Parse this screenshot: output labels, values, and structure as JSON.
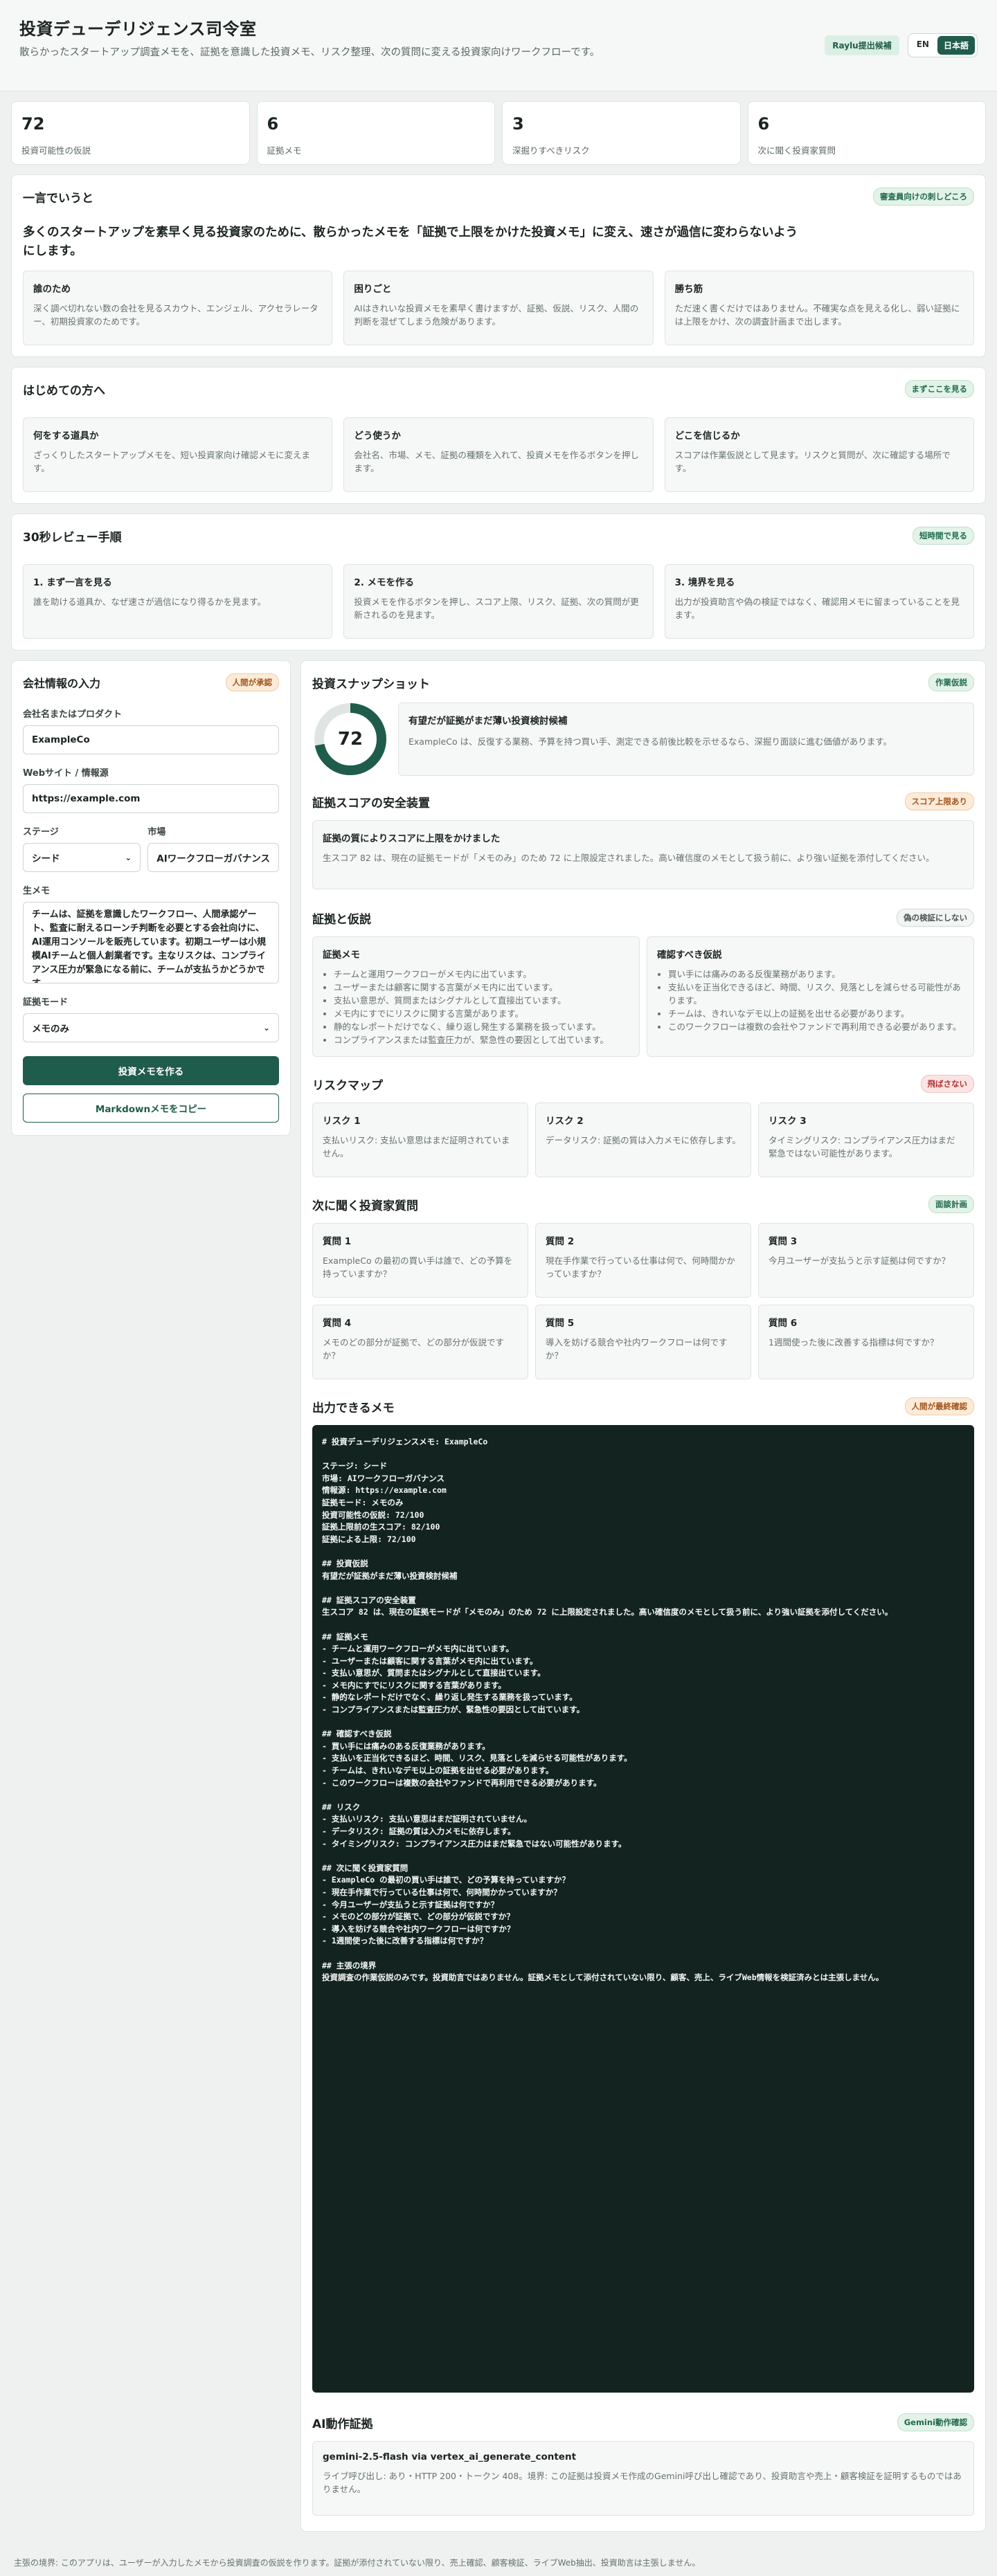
{
  "header": {
    "title": "投資デューデリジェンス司令室",
    "subtitle": "散らかったスタートアップ調査メモを、証拠を意識した投資メモ、リスク整理、次の質問に変える投資家向けワークフローです。",
    "badge": "Raylu提出候補",
    "lang_en": "EN",
    "lang_ja": "日本語"
  },
  "stats": [
    {
      "value": "72",
      "label": "投資可能性の仮説"
    },
    {
      "value": "6",
      "label": "証拠メモ"
    },
    {
      "value": "3",
      "label": "深掘りすべきリスク"
    },
    {
      "value": "6",
      "label": "次に聞く投資家質問"
    }
  ],
  "summary": {
    "title": "一言でいうと",
    "pill": "審査員向けの刺しどころ",
    "lead": "多くのスタートアップを素早く見る投資家のために、散らかったメモを「証拠で上限をかけた投資メモ」に変え、速さが過信に変わらないようにします。",
    "cards": [
      {
        "title": "誰のため",
        "body": "深く調べ切れない数の会社を見るスカウト、エンジェル、アクセラレーター、初期投資家のためです。"
      },
      {
        "title": "困りごと",
        "body": "AIはきれいな投資メモを素早く書けますが、証拠、仮説、リスク、人間の判断を混ぜてしまう危険があります。"
      },
      {
        "title": "勝ち筋",
        "body": "ただ速く書くだけではありません。不確実な点を見える化し、弱い証拠には上限をかけ、次の調査計画まで出します。"
      }
    ]
  },
  "intro": {
    "title": "はじめての方へ",
    "pill": "まずここを見る",
    "cards": [
      {
        "title": "何をする道具か",
        "body": "ざっくりしたスタートアップメモを、短い投資家向け確認メモに変えます。"
      },
      {
        "title": "どう使うか",
        "body": "会社名、市場、メモ、証拠の種類を入れて、投資メモを作るボタンを押します。"
      },
      {
        "title": "どこを信じるか",
        "body": "スコアは作業仮説として見ます。リスクと質問が、次に確認する場所です。"
      }
    ]
  },
  "review": {
    "title": "30秒レビュー手順",
    "pill": "短時間で見る",
    "cards": [
      {
        "title": "1. まず一言を見る",
        "body": "誰を助ける道具か、なぜ速さが過信になり得るかを見ます。"
      },
      {
        "title": "2. メモを作る",
        "body": "投資メモを作るボタンを押し、スコア上限、リスク、証拠、次の質問が更新されるのを見ます。"
      },
      {
        "title": "3. 境界を見る",
        "body": "出力が投資助言や偽の検証ではなく、確認用メモに留まっていることを見ます。"
      }
    ]
  },
  "form": {
    "title": "会社情報の入力",
    "pill": "人間が承認",
    "company_label": "会社名またはプロダクト",
    "company_value": "ExampleCo",
    "website_label": "Webサイト / 情報源",
    "website_value": "https://example.com",
    "stage_label": "ステージ",
    "stage_value": "シード",
    "market_label": "市場",
    "market_value": "AIワークフローガバナンス",
    "notes_label": "生メモ",
    "notes_value": "チームは、証拠を意識したワークフロー、人間承認ゲート、監査に耐えるローンチ判断を必要とする会社向けに、AI運用コンソールを販売しています。初期ユーザーは小規模AIチームと個人創業者です。主なリスクは、コンプライアンス圧力が緊急になる前に、チームが支払うかどうかです。",
    "mode_label": "証拠モード",
    "mode_value": "メモのみ",
    "generate_button": "投資メモを作る",
    "copy_button": "Markdownメモをコピー"
  },
  "snapshot": {
    "title": "投資スナップショット",
    "pill": "作業仮説",
    "score": "72",
    "score_fraction": 0.72,
    "heading": "有望だが証拠がまだ薄い投資検討候補",
    "body": "ExampleCo は、反復する業務、予算を持つ買い手、測定できる前後比較を示せるなら、深掘り面談に進む価値があります。"
  },
  "guard": {
    "title": "証拠スコアの安全装置",
    "pill": "スコア上限あり",
    "heading": "証拠の質によりスコアに上限をかけました",
    "body": "生スコア 82 は、現在の証拠モードが「メモのみ」のため 72 に上限設定されました。高い確信度のメモとして扱う前に、より強い証拠を添付してください。"
  },
  "evidence": {
    "title": "証拠と仮説",
    "pill": "偽の検証にしない",
    "memo_title": "証拠メモ",
    "memo_items": [
      "チームと運用ワークフローがメモ内に出ています。",
      "ユーザーまたは顧客に関する言葉がメモ内に出ています。",
      "支払い意思が、質問またはシグナルとして直接出ています。",
      "メモ内にすでにリスクに関する言葉があります。",
      "静的なレポートだけでなく、繰り返し発生する業務を扱っています。",
      "コンプライアンスまたは監査圧力が、緊急性の要因として出ています。"
    ],
    "hyp_title": "確認すべき仮説",
    "hyp_items": [
      "買い手には痛みのある反復業務があります。",
      "支払いを正当化できるほど、時間、リスク、見落としを減らせる可能性があります。",
      "チームは、きれいなデモ以上の証拠を出せる必要があります。",
      "このワークフローは複数の会社やファンドで再利用できる必要があります。"
    ]
  },
  "risks": {
    "title": "リスクマップ",
    "pill": "飛ばさない",
    "items": [
      {
        "title": "リスク 1",
        "body": "支払いリスク: 支払い意思はまだ証明されていません。"
      },
      {
        "title": "リスク 2",
        "body": "データリスク: 証拠の質は入力メモに依存します。"
      },
      {
        "title": "リスク 3",
        "body": "タイミングリスク: コンプライアンス圧力はまだ緊急ではない可能性があります。"
      }
    ]
  },
  "questions": {
    "title": "次に聞く投資家質問",
    "pill": "面談計画",
    "items": [
      {
        "title": "質問 1",
        "body": "ExampleCo の最初の買い手は誰で、どの予算を持っていますか？"
      },
      {
        "title": "質問 2",
        "body": "現在手作業で行っている仕事は何で、何時間かかっていますか？"
      },
      {
        "title": "質問 3",
        "body": "今月ユーザーが支払うと示す証拠は何ですか？"
      },
      {
        "title": "質問 4",
        "body": "メモのどの部分が証拠で、どの部分が仮説ですか？"
      },
      {
        "title": "質問 5",
        "body": "導入を妨げる競合や社内ワークフローは何ですか？"
      },
      {
        "title": "質問 6",
        "body": "1週間使った後に改善する指標は何ですか？"
      }
    ]
  },
  "output": {
    "title": "出力できるメモ",
    "pill": "人間が最終確認",
    "markdown": "# 投資デューデリジェンスメモ: ExampleCo\n\nステージ: シード\n市場: AIワークフローガバナンス\n情報源: https://example.com\n証拠モード: メモのみ\n投資可能性の仮説: 72/100\n証拠上限前の生スコア: 82/100\n証拠による上限: 72/100\n\n## 投資仮説\n有望だが証拠がまだ薄い投資検討候補\n\n## 証拠スコアの安全装置\n生スコア 82 は、現在の証拠モードが「メモのみ」のため 72 に上限設定されました。高い確信度のメモとして扱う前に、より強い証拠を添付してください。\n\n## 証拠メモ\n- チームと運用ワークフローがメモ内に出ています。\n- ユーザーまたは顧客に関する言葉がメモ内に出ています。\n- 支払い意思が、質問またはシグナルとして直接出ています。\n- メモ内にすでにリスクに関する言葉があります。\n- 静的なレポートだけでなく、繰り返し発生する業務を扱っています。\n- コンプライアンスまたは監査圧力が、緊急性の要因として出ています。\n\n## 確認すべき仮説\n- 買い手には痛みのある反復業務があります。\n- 支払いを正当化できるほど、時間、リスク、見落としを減らせる可能性があります。\n- チームは、きれいなデモ以上の証拠を出せる必要があります。\n- このワークフローは複数の会社やファンドで再利用できる必要があります。\n\n## リスク\n- 支払いリスク: 支払い意思はまだ証明されていません。\n- データリスク: 証拠の質は入力メモに依存します。\n- タイミングリスク: コンプライアンス圧力はまだ緊急ではない可能性があります。\n\n## 次に聞く投資家質問\n- ExampleCo の最初の買い手は誰で、どの予算を持っていますか？\n- 現在手作業で行っている仕事は何で、何時間かかっていますか？\n- 今月ユーザーが支払うと示す証拠は何ですか？\n- メモのどの部分が証拠で、どの部分が仮説ですか？\n- 導入を妨げる競合や社内ワークフローは何ですか？\n- 1週間使った後に改善する指標は何ですか？\n\n## 主張の境界\n投資調査の作業仮説のみです。投資助言ではありません。証拠メモとして添付されていない限り、顧客、売上、ライブWeb情報を検証済みとは主張しません。"
  },
  "ai": {
    "title": "AI動作証拠",
    "pill": "Gemini動作確認",
    "heading": "gemini-2.5-flash via vertex_ai_generate_content",
    "body": "ライブ呼び出し: あり・HTTP 200・トークン 408。境界: この証拠は投資メモ作成のGemini呼び出し確認であり、投資助言や売上・顧客検証を証明するものではありません。"
  },
  "footer": "主張の境界: このアプリは、ユーザーが入力したメモから投資調査の仮説を作ります。証拠が添付されていない限り、売上確認、顧客検証、ライブWeb抽出、投資助言は主張しません。",
  "colors": {
    "accent": "#1f5c4c",
    "memo_bg": "#132420"
  }
}
